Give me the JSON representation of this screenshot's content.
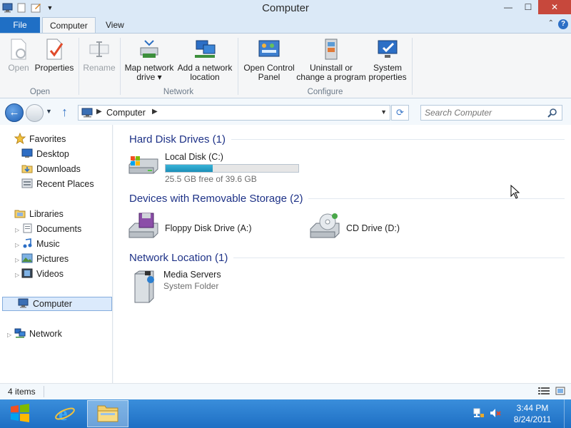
{
  "window": {
    "title": "Computer",
    "controls": {
      "minimize": "—",
      "maximize": "☐",
      "close": "✕"
    }
  },
  "ribbon": {
    "tabs": {
      "file": "File",
      "computer": "Computer",
      "view": "View"
    },
    "buttons": {
      "open": "Open",
      "properties": "Properties",
      "rename": "Rename",
      "map_network_drive": "Map network drive ▾",
      "add_network_location": "Add a network location",
      "open_control_panel": "Open Control Panel",
      "uninstall_program": "Uninstall or change a program",
      "system_properties": "System properties"
    },
    "groups": {
      "open": "Open",
      "network": "Network",
      "configure": "Configure"
    },
    "help": "?"
  },
  "address": {
    "breadcrumb": "Computer",
    "search_placeholder": "Search Computer"
  },
  "navpane": {
    "favorites": "Favorites",
    "desktop": "Desktop",
    "downloads": "Downloads",
    "recent_places": "Recent Places",
    "libraries": "Libraries",
    "documents": "Documents",
    "music": "Music",
    "pictures": "Pictures",
    "videos": "Videos",
    "computer": "Computer",
    "network": "Network"
  },
  "content": {
    "groups": {
      "hard_disk": "Hard Disk Drives (1)",
      "removable": "Devices with Removable Storage (2)",
      "network_location": "Network Location (1)"
    },
    "local_disk": {
      "label": "Local Disk (C:)",
      "free_text": "25.5 GB free of 39.6 GB",
      "used_fraction": 0.356
    },
    "floppy": {
      "label": "Floppy Disk Drive (A:)"
    },
    "cd": {
      "label": "CD Drive (D:)"
    },
    "media_servers": {
      "label": "Media Servers",
      "sub": "System Folder"
    }
  },
  "status": {
    "items": "4 items"
  },
  "taskbar": {
    "time": "3:44 PM",
    "date": "8/24/2011"
  },
  "colors": {
    "accent": "#1f6fc5",
    "taskbar": "#2a7fd2",
    "group_header": "#1e3287",
    "progress": "#26a0c9"
  }
}
